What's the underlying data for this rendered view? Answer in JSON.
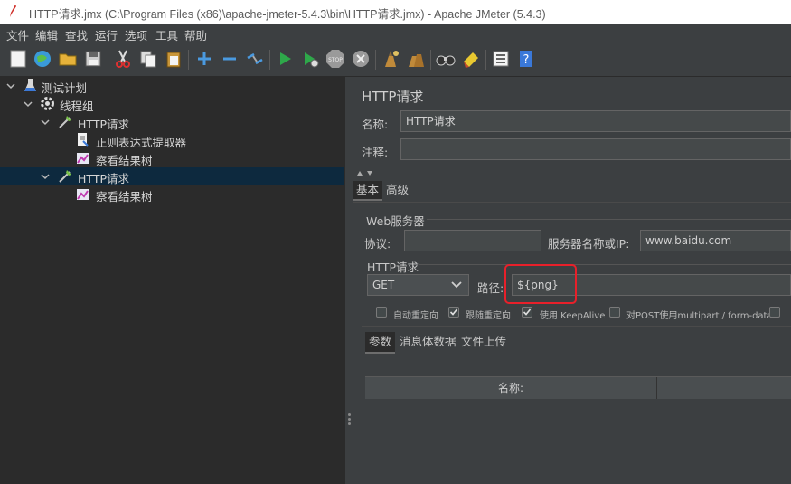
{
  "window": {
    "title": "HTTP请求.jmx (C:\\Program Files (x86)\\apache-jmeter-5.4.3\\bin\\HTTP请求.jmx) - Apache JMeter (5.4.3)"
  },
  "menu": [
    "文件",
    "编辑",
    "查找",
    "运行",
    "选项",
    "工具",
    "帮助"
  ],
  "toolbar": {
    "icons": [
      "new-icon",
      "templates-icon",
      "open-icon",
      "save-icon",
      "cut-icon",
      "copy-icon",
      "paste-icon",
      "expand-icon",
      "collapse-icon",
      "toggle-icon",
      "start-icon",
      "start-no-pause-icon",
      "stop-icon",
      "shutdown-icon",
      "clear-icon",
      "clear-all-icon",
      "search-icon",
      "reset-search-icon",
      "function-helper-icon",
      "help-icon"
    ]
  },
  "tree": {
    "items": [
      {
        "label": "测试计划",
        "icon": "test-plan-icon"
      },
      {
        "label": "线程组",
        "icon": "thread-group-icon"
      },
      {
        "label": "HTTP请求",
        "icon": "sampler-icon"
      },
      {
        "label": "正则表达式提取器",
        "icon": "extractor-icon"
      },
      {
        "label": "察看结果树",
        "icon": "listener-icon"
      },
      {
        "label": "HTTP请求",
        "icon": "sampler-icon",
        "selected": true
      },
      {
        "label": "察看结果树",
        "icon": "listener-icon"
      }
    ]
  },
  "panel": {
    "title": "HTTP请求",
    "name_label": "名称:",
    "name_value": "HTTP请求",
    "comment_label": "注释:",
    "comment_value": "",
    "tabs": [
      "基本",
      "高级"
    ],
    "web_server": {
      "group_title": "Web服务器",
      "protocol_label": "协议:",
      "protocol_value": "",
      "server_label": "服务器名称或IP:",
      "server_value": "www.baidu.com"
    },
    "http_request": {
      "group_title": "HTTP请求",
      "method_value": "GET",
      "path_label": "路径:",
      "path_value": "${png}"
    },
    "options": [
      {
        "label": "自动重定向",
        "checked": false
      },
      {
        "label": "跟随重定向",
        "checked": true
      },
      {
        "label": "使用 KeepAlive",
        "checked": true
      },
      {
        "label": "对POST使用multipart / form-data",
        "checked": false
      }
    ],
    "sub_tabs": [
      "参数",
      "消息体数据",
      "文件上传"
    ],
    "params_table": {
      "columns": [
        "名称:",
        ""
      ]
    }
  },
  "colors": {
    "highlight": "#e8202a",
    "selection": "#0d293e"
  }
}
